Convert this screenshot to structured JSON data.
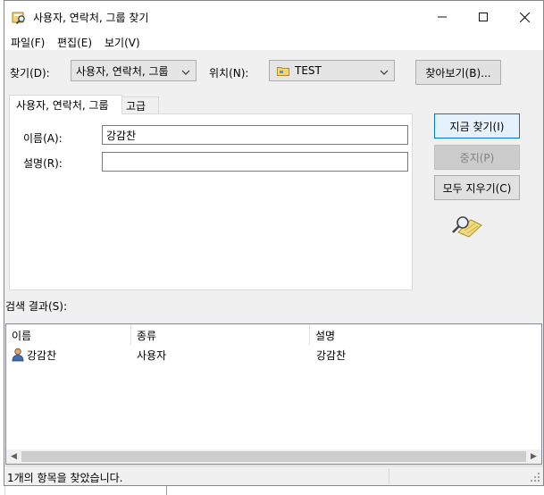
{
  "window": {
    "title": "사용자, 연락처, 그룹 찾기",
    "icon": "find-people-icon",
    "min_glyph": "—",
    "max_glyph": "☐",
    "close_glyph": "✕"
  },
  "menu": {
    "file": "파일(F)",
    "edit": "편집(E)",
    "view": "보기(V)"
  },
  "find": {
    "label": "찾기(D):",
    "value": "사용자, 연락처, 그룹"
  },
  "location": {
    "label": "위치(N):",
    "value": "TEST",
    "icon": "domain-folder-icon"
  },
  "browse_button": "찾아보기(B)...",
  "tabs": {
    "main": "사용자, 연락처, 그룹",
    "advanced": "고급"
  },
  "form": {
    "name_label": "이름(A):",
    "name_value": "강감찬",
    "desc_label": "설명(R):",
    "desc_value": ""
  },
  "buttons": {
    "find_now": "지금 찾기(I)",
    "stop": "중지(P)",
    "clear_all": "모두 지우기(C)"
  },
  "results": {
    "label": "검색 결과(S):",
    "columns": [
      "이름",
      "종류",
      "설명"
    ],
    "rows": [
      {
        "icon": "user-icon",
        "name": "강감찬",
        "type": "사용자",
        "description": "강감찬"
      }
    ]
  },
  "status": "1개의 항목을 찾았습니다.",
  "colors": {
    "accent": "#0078d7",
    "dialog_bg": "#f0f0f0"
  }
}
